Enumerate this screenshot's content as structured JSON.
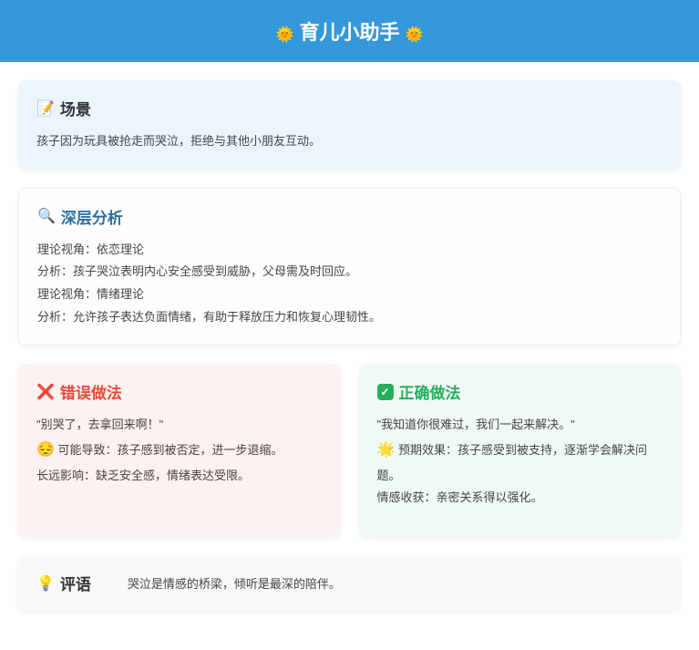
{
  "header": {
    "emoji_left": "🌞",
    "title": "育儿小助手",
    "emoji_right": "🌞"
  },
  "scene": {
    "icon": "📝",
    "title": "场景",
    "text": "孩子因为玩具被抢走而哭泣，拒绝与其他小朋友互动。"
  },
  "analysis": {
    "icon": "🔍",
    "title": "深层分析",
    "lines": [
      "理论视角：依恋理论",
      "分析：孩子哭泣表明内心安全感受到威胁，父母需及时回应。",
      "理论视角：情绪理论",
      "分析：允许孩子表达负面情绪，有助于释放压力和恢复心理韧性。"
    ]
  },
  "wrong": {
    "icon": "❌",
    "title": "错误做法",
    "quote": "\"别哭了，去拿回来啊！\"",
    "line1_icon": "😔",
    "line1": "可能导致：孩子感到被否定，进一步退缩。",
    "line2": "长远影响：缺乏安全感，情绪表达受限。"
  },
  "right": {
    "title": "正确做法",
    "quote": "\"我知道你很难过，我们一起来解决。\"",
    "line1_icon": "🌟",
    "line1": "预期效果：孩子感受到被支持，逐渐学会解决问题。",
    "line2": "情感收获：亲密关系得以强化。"
  },
  "summary": {
    "icon": "💡",
    "label": "评语",
    "text": "哭泣是情感的桥梁，倾听是最深的陪伴。"
  }
}
